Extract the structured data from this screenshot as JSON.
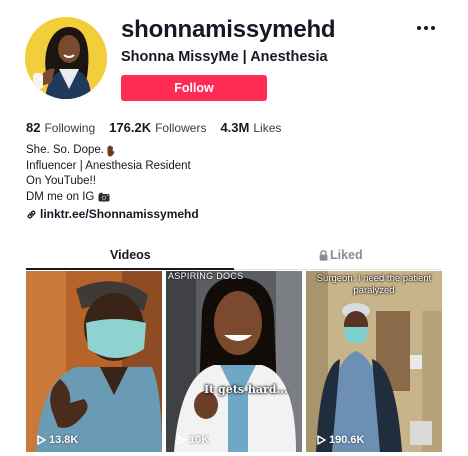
{
  "profile": {
    "username": "shonnamissymehd",
    "nickname": "Shonna MissyMe | Anesthesia",
    "follow_label": "Follow",
    "avatar_bg": "#f2cf3a"
  },
  "stats": {
    "following_count": "82",
    "following_label": "Following",
    "followers_count": "176.2K",
    "followers_label": "Followers",
    "likes_count": "4.3M",
    "likes_label": "Likes"
  },
  "bio": {
    "line1": "She. So. Dope.",
    "line1_emoji": "raised-hand-dark-skin-tone",
    "line2": "Influencer | Anesthesia Resident",
    "line3": "On YouTube!!",
    "line4": "DM me on IG",
    "line4_emoji": "camera-with-flash"
  },
  "link": {
    "text": "linktr.ee/Shonnamissymehd",
    "icon": "link-icon"
  },
  "tabs": {
    "videos": "Videos",
    "liked": "Liked",
    "liked_icon": "lock-icon"
  },
  "videos": [
    {
      "views": "13.8K",
      "caption": ""
    },
    {
      "views": "10K",
      "caption": "It gets hard...",
      "top_caption": "ASPIRING DOCS"
    },
    {
      "views": "190.6K",
      "caption": "Surgeon: I need the patient paralyzed"
    }
  ],
  "colors": {
    "accent": "#fe2c55",
    "text": "#161823",
    "muted": "#8a8b91"
  }
}
